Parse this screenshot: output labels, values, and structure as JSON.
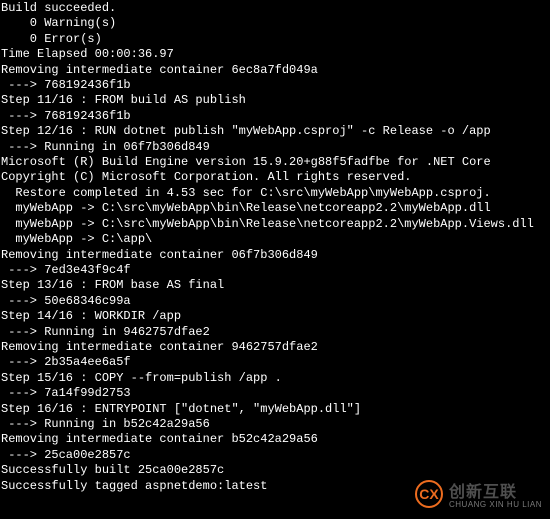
{
  "lines": [
    "Build succeeded.",
    "    0 Warning(s)",
    "    0 Error(s)",
    "",
    "Time Elapsed 00:00:36.97",
    "Removing intermediate container 6ec8a7fd049a",
    " ---> 768192436f1b",
    "Step 11/16 : FROM build AS publish",
    " ---> 768192436f1b",
    "Step 12/16 : RUN dotnet publish \"myWebApp.csproj\" -c Release -o /app",
    " ---> Running in 06f7b306d849",
    "Microsoft (R) Build Engine version 15.9.20+g88f5fadfbe for .NET Core",
    "Copyright (C) Microsoft Corporation. All rights reserved.",
    "",
    "  Restore completed in 4.53 sec for C:\\src\\myWebApp\\myWebApp.csproj.",
    "  myWebApp -> C:\\src\\myWebApp\\bin\\Release\\netcoreapp2.2\\myWebApp.dll",
    "  myWebApp -> C:\\src\\myWebApp\\bin\\Release\\netcoreapp2.2\\myWebApp.Views.dll",
    "  myWebApp -> C:\\app\\",
    "Removing intermediate container 06f7b306d849",
    " ---> 7ed3e43f9c4f",
    "Step 13/16 : FROM base AS final",
    " ---> 50e68346c99a",
    "Step 14/16 : WORKDIR /app",
    " ---> Running in 9462757dfae2",
    "Removing intermediate container 9462757dfae2",
    " ---> 2b35a4ee6a5f",
    "Step 15/16 : COPY --from=publish /app .",
    " ---> 7a14f99d2753",
    "Step 16/16 : ENTRYPOINT [\"dotnet\", \"myWebApp.dll\"]",
    " ---> Running in b52c42a29a56",
    "Removing intermediate container b52c42a29a56",
    " ---> 25ca00e2857c",
    "Successfully built 25ca00e2857c",
    "Successfully tagged aspnetdemo:latest"
  ],
  "watermark": {
    "logo_text": "CX",
    "cn": "创新互联",
    "en": "CHUANG XIN HU LIAN"
  }
}
